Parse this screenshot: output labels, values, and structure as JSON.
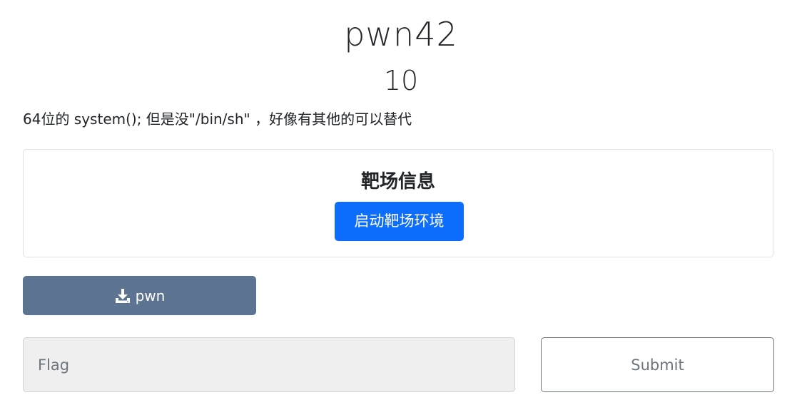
{
  "challenge": {
    "name": "pwn42",
    "value": "10",
    "description": "64位的 system(); 但是没\"/bin/sh\" ，好像有其他的可以替代"
  },
  "target_info": {
    "title": "靶场信息",
    "start_button_label": "启动靶场环境"
  },
  "download": {
    "icon": "download-icon",
    "label": "pwn"
  },
  "flag_form": {
    "placeholder": "Flag",
    "value": "",
    "submit_label": "Submit"
  },
  "colors": {
    "primary": "#0d6efd",
    "download_button": "#5c7391",
    "input_background": "#efefef",
    "submit_border": "#6c757d"
  }
}
